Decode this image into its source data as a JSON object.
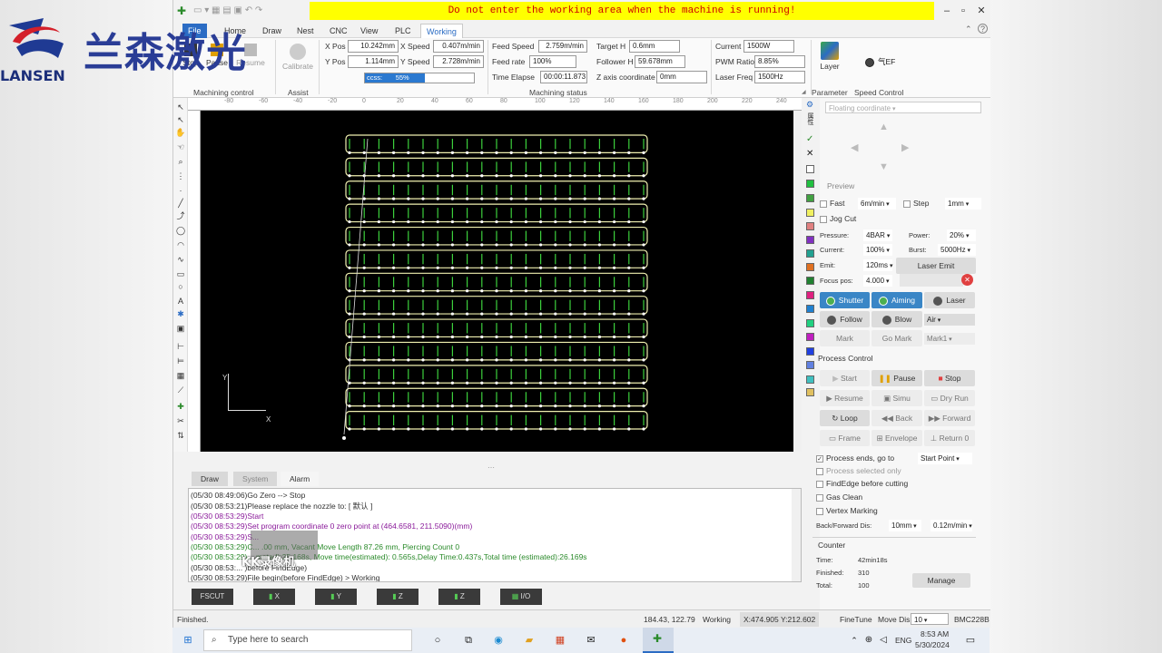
{
  "brand": {
    "name_en": "LANSEN",
    "name_cn": "兰森激光"
  },
  "titlebar": {
    "warning": "Do not enter the working area when the machine is running!"
  },
  "tabs": [
    "File",
    "Home",
    "Draw",
    "Nest",
    "CNC",
    "View",
    "PLC",
    "Working"
  ],
  "machining_control": {
    "stop": "Stop",
    "pause": "Pause",
    "resume": "Resume",
    "group": "Machining control"
  },
  "assist": {
    "calibrate": "Calibrate",
    "group": "Assist"
  },
  "position": {
    "xpos_label": "X Pos",
    "xpos": "10.242mm",
    "ypos_label": "Y Pos",
    "ypos": "1.114mm",
    "xspeed_label": "X Speed",
    "xspeed": "0.407m/min",
    "yspeed_label": "Y Speed",
    "yspeed": "2.728m/min",
    "progress_label": "ccss:",
    "progress": "55%",
    "progress_value": 0.55
  },
  "status": {
    "feed_speed_label": "Feed Speed",
    "feed_speed": "2.759m/min",
    "feed_rate_label": "Feed rate",
    "feed_rate": "100%",
    "time_label": "Time Elapse",
    "time": "00:00:11.873",
    "target_h_label": "Target H",
    "target_h": "0.6mm",
    "follower_h_label": "Follower H",
    "follower_h": "59.678mm",
    "z_label": "Z axis coordinate",
    "z": "0mm",
    "group": "Machining status"
  },
  "laser": {
    "current_label": "Current",
    "current": "1500W",
    "pwm_label": "PWM Ratio",
    "pwm": "8.85%",
    "freq_label": "Laser Freq",
    "freq": "1500Hz"
  },
  "parameter": {
    "layer": "Layer",
    "group": "Parameter"
  },
  "speed_control": {
    "toggle": "气EF",
    "group": "Speed Control"
  },
  "canvas": {
    "axis_x": "X",
    "axis_y": "Y",
    "ruler_h": [
      "-80",
      "-60",
      "-40",
      "-20",
      "0",
      "20",
      "40",
      "60",
      "80",
      "100",
      "120",
      "140",
      "160",
      "180",
      "200",
      "220",
      "240"
    ]
  },
  "side": {
    "coord_select": "Floating coordinate",
    "preview": "Preview",
    "fast_label": "Fast",
    "fast_speed": "6m/min",
    "step_label": "Step",
    "step_val": "1mm",
    "jog_cut": "Jog Cut",
    "pressure_label": "Pressure:",
    "pressure": "4BAR",
    "power_label": "Power:",
    "power": "20%",
    "current_label": "Current:",
    "current": "100%",
    "burst_label": "Burst:",
    "burst": "5000Hz",
    "emit_label": "Emit:",
    "emit": "120ms",
    "laser_emit": "Laser Emit",
    "focus_label": "Focus pos:",
    "focus": "4.000",
    "shutter": "Shutter",
    "aiming": "Aiming",
    "laser": "Laser",
    "follow": "Follow",
    "blow": "Blow",
    "gas": "Air",
    "mark": "Mark",
    "go_mark": "Go Mark",
    "mark1": "Mark1",
    "process_control": "Process Control",
    "start": "Start",
    "pause": "Pause",
    "stop": "Stop",
    "resume": "Resume",
    "simu": "Simu",
    "dry_run": "Dry Run",
    "loop": "Loop",
    "back": "Back",
    "forward": "Forward",
    "frame": "Frame",
    "envelope": "Envelope",
    "return0": "Return 0",
    "process_ends": "Process ends, go to",
    "process_ends_target": "Start Point",
    "process_selected": "Process selected only",
    "findedge": "FindEdge before cutting",
    "gas_clean": "Gas Clean",
    "vertex_marking": "Vertex Marking",
    "backforward_label": "Back/Forward Dis:",
    "backforward_dis": "10mm",
    "backforward_speed": "0.12m/min",
    "counter": "Counter",
    "time_label": "Time:",
    "time": "42min18s",
    "finished_label": "Finished:",
    "finished": "310",
    "total_label": "Total:",
    "total": "100",
    "manage": "Manage"
  },
  "log_tabs": [
    "Draw",
    "System",
    "Alarm"
  ],
  "log": [
    {
      "text": "(05/30 08:49:06)Go Zero --> Stop",
      "color": "#333"
    },
    {
      "text": "(05/30 08:53:21)Please replace the nozzle to: [ 默认 ]",
      "color": "#333"
    },
    {
      "text": "(05/30 08:53:29)Start",
      "color": "#8a1a9a"
    },
    {
      "text": "(05/30 08:53:29)Set program coordinate 0 zero point at (464.6581, 211.5090)(mm)",
      "color": "#8a1a9a"
    },
    {
      "text": "(05/30 08:53:29)S...",
      "color": "#8a1a9a"
    },
    {
      "text": "(05/30 08:53:29)C...          .00 mm, Vacant Move Length 87.26 mm, Piercing Count 0",
      "color": "#2a8a2a"
    },
    {
      "text": "(05/30 08:53:29)...           mated):25.168s, Move time(estimated): 0.565s,Delay Time:0.437s,Total time (estimated):26.169s",
      "color": "#2a8a2a"
    },
    {
      "text": "(05/30 08:53:...             )before FindEdge)",
      "color": "#333"
    },
    {
      "text": "(05/30 08:53:29)File begin(before FindEdge)    > Working",
      "color": "#333"
    }
  ],
  "watermark": "KK录像机",
  "io_buttons": [
    "FSCUT",
    "X",
    "Y",
    "Z",
    "Z",
    "I/O"
  ],
  "statusbar": {
    "left": "Finished.",
    "coords": "184.43, 122.79",
    "state": "Working",
    "xy": "X:474.905 Y:212.602",
    "finetune": "FineTune",
    "move_dis_label": "Move Dis",
    "move_dis": "10",
    "board": "BMC228B"
  },
  "taskbar": {
    "search": "Type here to search",
    "time": "8:53 AM",
    "date": "5/30/2024",
    "lang": "ENG"
  }
}
